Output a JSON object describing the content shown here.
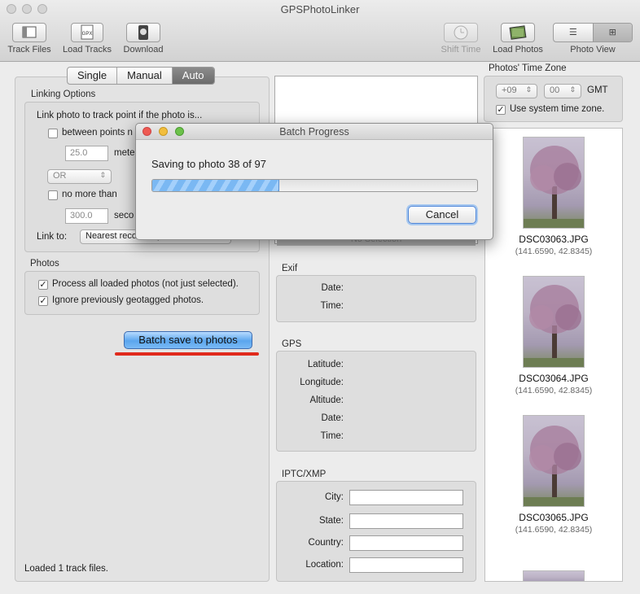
{
  "window": {
    "title": "GPSPhotoLinker"
  },
  "toolbar": {
    "track_files": "Track Files",
    "load_tracks": "Load Tracks",
    "download": "Download",
    "shift_time": "Shift Time",
    "load_photos": "Load Photos",
    "photo_view": "Photo View",
    "gpx_icon_text": "GPX"
  },
  "mode_tabs": [
    "Single",
    "Manual",
    "Auto"
  ],
  "selected_mode": "Auto",
  "linking": {
    "section_title": "Linking Options",
    "intro": "Link photo to track point if the photo is...",
    "between_points": "between points n",
    "meters_value": "25.0",
    "meters_unit": "mete",
    "or_value": "OR",
    "no_more_than": "no more than",
    "seconds_value": "300.0",
    "seconds_unit": "seco",
    "link_to_label": "Link to:",
    "link_to_value": "Nearest recorded point"
  },
  "photos_options": {
    "section_title": "Photos",
    "process_all": "Process all loaded photos (not just selected).",
    "ignore_geotagged": "Ignore previously geotagged photos.",
    "batch_button": "Batch save to photos"
  },
  "status": "Loaded 1 track files.",
  "middle": {
    "no_selection": "No Selection",
    "exif_title": "Exif",
    "exif_date": "Date:",
    "exif_time": "Time:",
    "gps_title": "GPS",
    "gps_latitude": "Latitude:",
    "gps_longitude": "Longitude:",
    "gps_altitude": "Altitude:",
    "gps_date": "Date:",
    "gps_time": "Time:",
    "iptc_title": "IPTC/XMP",
    "iptc_city": "City:",
    "iptc_state": "State:",
    "iptc_country": "Country:",
    "iptc_location": "Location:"
  },
  "timezone": {
    "title": "Photos' Time Zone",
    "hours": "+09",
    "minutes": "00",
    "gmt": "GMT",
    "use_system": "Use system time zone."
  },
  "photos": [
    {
      "name": "DSC03063.JPG",
      "coords": "(141.6590, 42.8345)"
    },
    {
      "name": "DSC03064.JPG",
      "coords": "(141.6590, 42.8345)"
    },
    {
      "name": "DSC03065.JPG",
      "coords": "(141.6590, 42.8345)"
    }
  ],
  "dialog": {
    "title": "Batch Progress",
    "message": "Saving to photo 38 of 97",
    "progress": 0.392,
    "cancel": "Cancel"
  },
  "colors": {
    "accent_blue": "#5ba6ee",
    "highlight_red": "#e02a1c"
  }
}
